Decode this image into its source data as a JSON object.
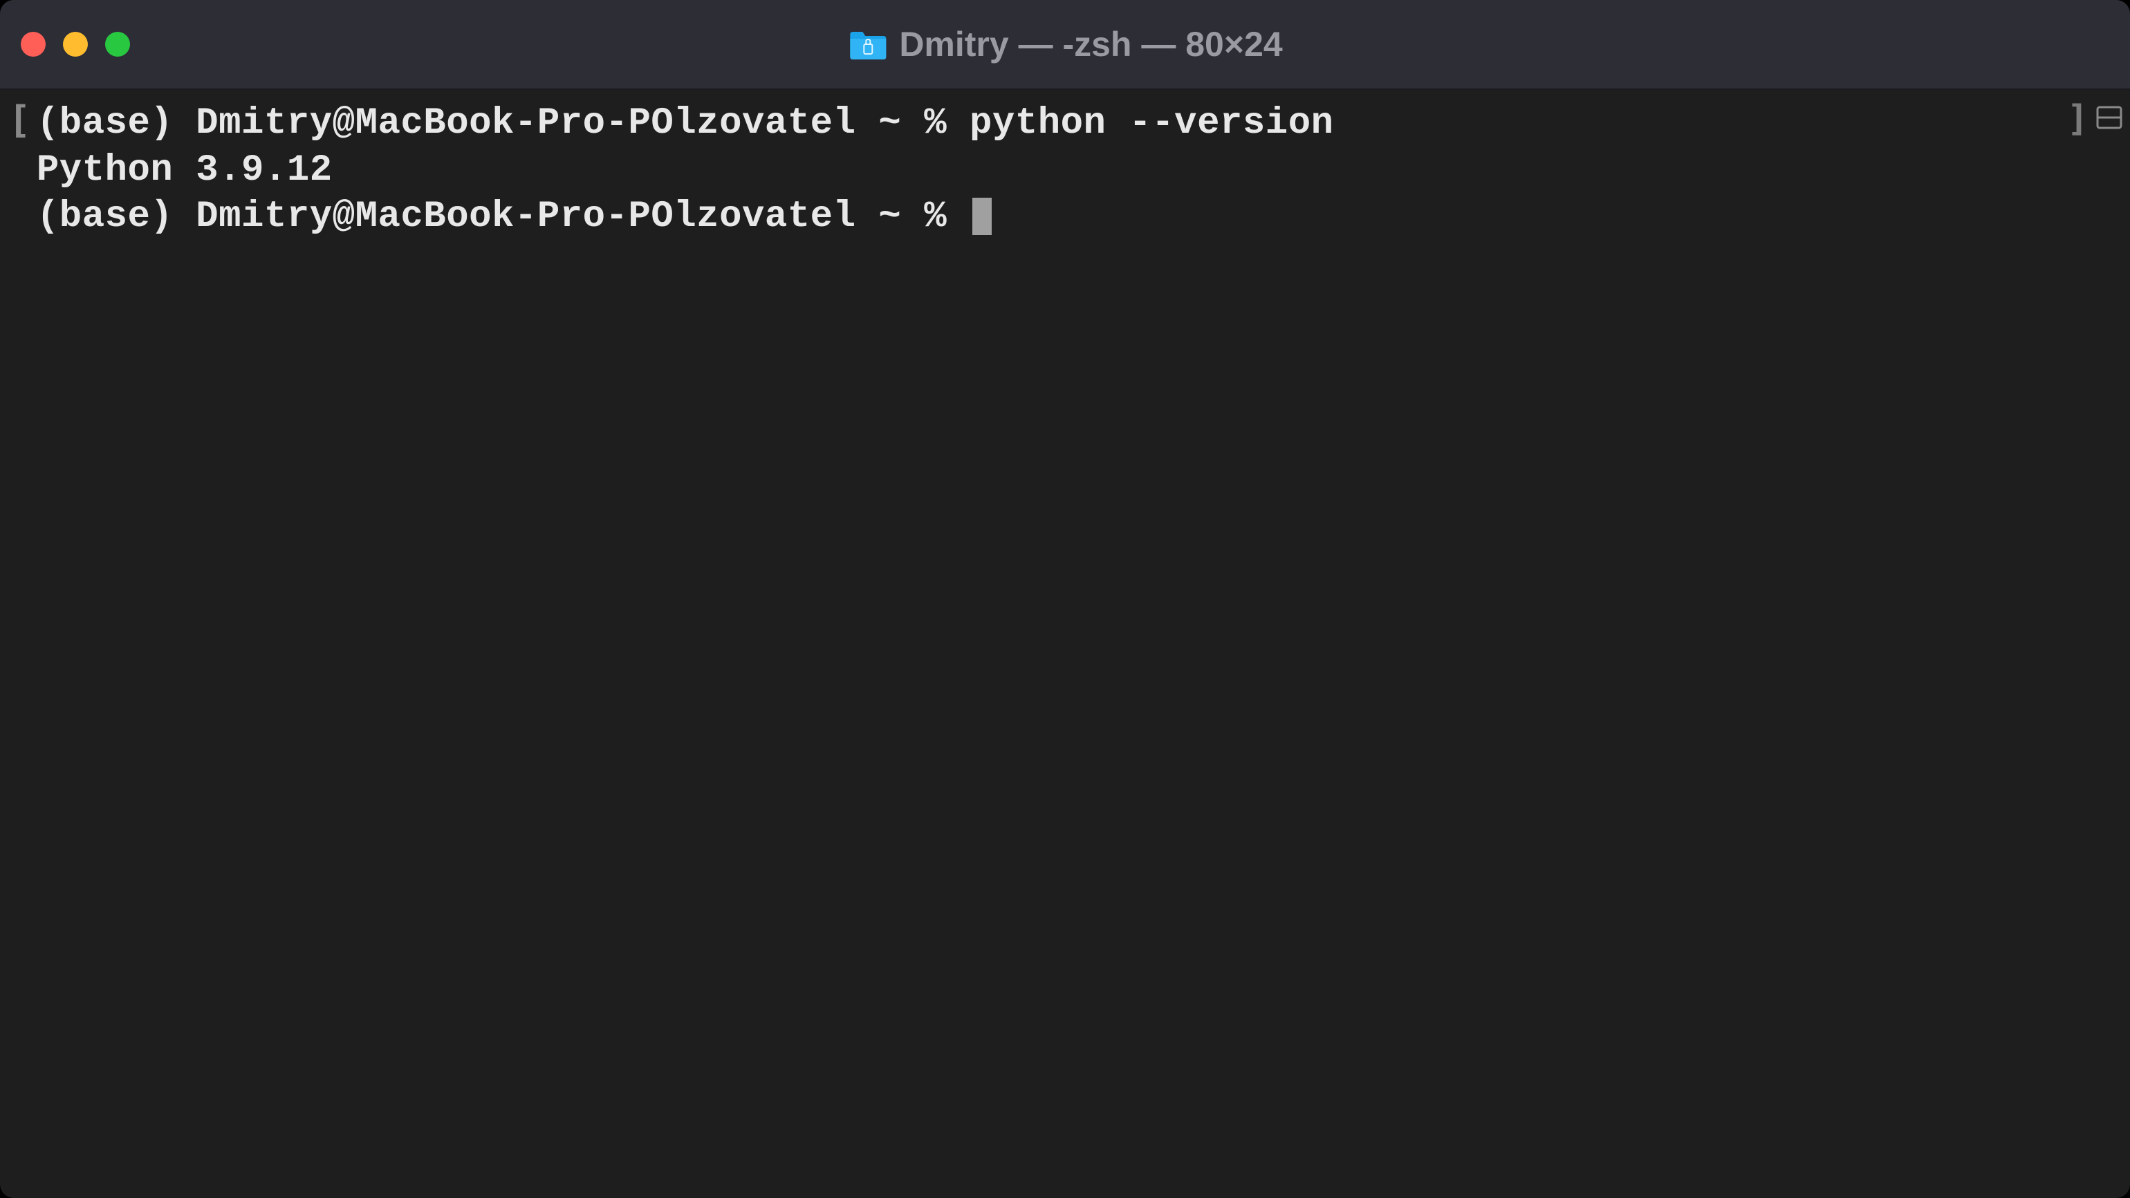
{
  "window": {
    "title": "Dmitry — -zsh — 80×24"
  },
  "terminal": {
    "line1_prompt": "(base) Dmitry@MacBook-Pro-POlzovatel ~ % ",
    "line1_command": "python --version",
    "line2_output": "Python 3.9.12",
    "line3_prompt": "(base) Dmitry@MacBook-Pro-POlzovatel ~ % "
  },
  "brackets": {
    "left": "[",
    "right": "]"
  }
}
